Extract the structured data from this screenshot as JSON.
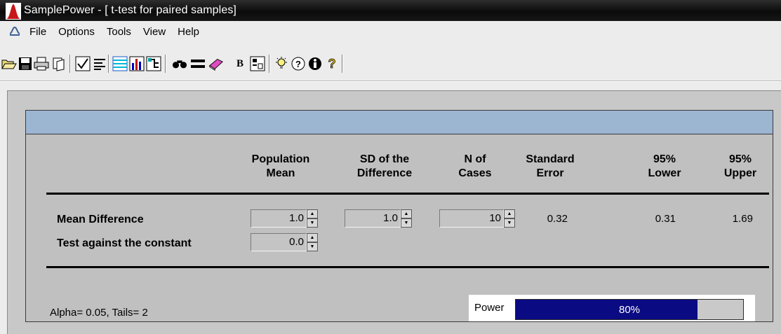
{
  "window": {
    "title": "SamplePower - [ t-test for paired samples]"
  },
  "menu": {
    "items": [
      "File",
      "Options",
      "Tools",
      "View",
      "Help"
    ]
  },
  "toolbar": {
    "buttons": [
      "open-icon",
      "save-icon",
      "print-icon",
      "copy-icon",
      "check-icon",
      "report-icon",
      "table-icon",
      "chart-icon",
      "tree-icon",
      "find-icon",
      "equals-icon",
      "eraser-icon",
      "bold-icon",
      "calc-icon",
      "idea-icon",
      "tip-icon",
      "info-icon",
      "help-icon"
    ],
    "bold_label": "B"
  },
  "columns": {
    "population_mean": [
      "Population",
      "Mean"
    ],
    "sd_difference": [
      "SD of the",
      "Difference"
    ],
    "n_cases": [
      "N of",
      "Cases"
    ],
    "standard_error": [
      "Standard",
      "Error"
    ],
    "lower": [
      "95%",
      "Lower"
    ],
    "upper": [
      "95%",
      "Upper"
    ]
  },
  "rows": {
    "mean_difference": {
      "label": "Mean Difference",
      "population_mean": "1.0",
      "sd_difference": "1.0",
      "n_cases": "10",
      "standard_error": "0.32",
      "lower": "0.31",
      "upper": "1.69"
    },
    "test_constant": {
      "label": "Test against the constant",
      "population_mean": "0.0"
    }
  },
  "footer": {
    "alpha_tails": "Alpha= 0.05, Tails=  2"
  },
  "power": {
    "label": "Power",
    "value_text": "80%",
    "fraction": 0.8
  },
  "colors": {
    "header_band": "#9cb6d2",
    "power_fill": "#0a0a82"
  }
}
